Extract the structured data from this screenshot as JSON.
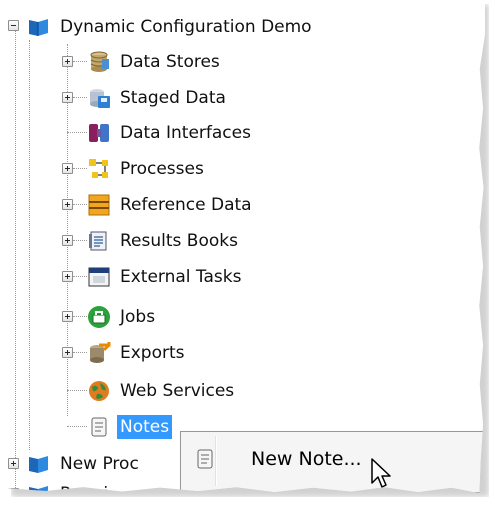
{
  "tree": {
    "root": {
      "label": "Dynamic Configuration Demo",
      "icon": "project-book-icon"
    },
    "children": [
      {
        "label": "Data Stores",
        "icon": "database-icon"
      },
      {
        "label": "Staged Data",
        "icon": "staged-data-icon"
      },
      {
        "label": "Data Interfaces",
        "icon": "interface-icon"
      },
      {
        "label": "Processes",
        "icon": "process-icon"
      },
      {
        "label": "Reference Data",
        "icon": "reference-data-icon"
      },
      {
        "label": "Results Books",
        "icon": "results-book-icon"
      },
      {
        "label": "External Tasks",
        "icon": "external-task-icon"
      },
      {
        "label": "Jobs",
        "icon": "jobs-icon"
      },
      {
        "label": "Exports",
        "icon": "exports-icon"
      },
      {
        "label": "Web Services",
        "icon": "web-services-icon"
      },
      {
        "label": "Notes",
        "icon": "notes-icon"
      }
    ],
    "siblings": [
      {
        "label": "New Proc",
        "icon": "project-book-icon"
      },
      {
        "label": "Runni",
        "icon": "project-book-icon"
      }
    ]
  },
  "context_menu": {
    "items": [
      {
        "label": "New Note...",
        "icon": "note-icon"
      }
    ]
  },
  "colors": {
    "selection": "#3399ff",
    "tree_lines": "#9a9a9a",
    "menu_bg": "#f5f5f5"
  }
}
